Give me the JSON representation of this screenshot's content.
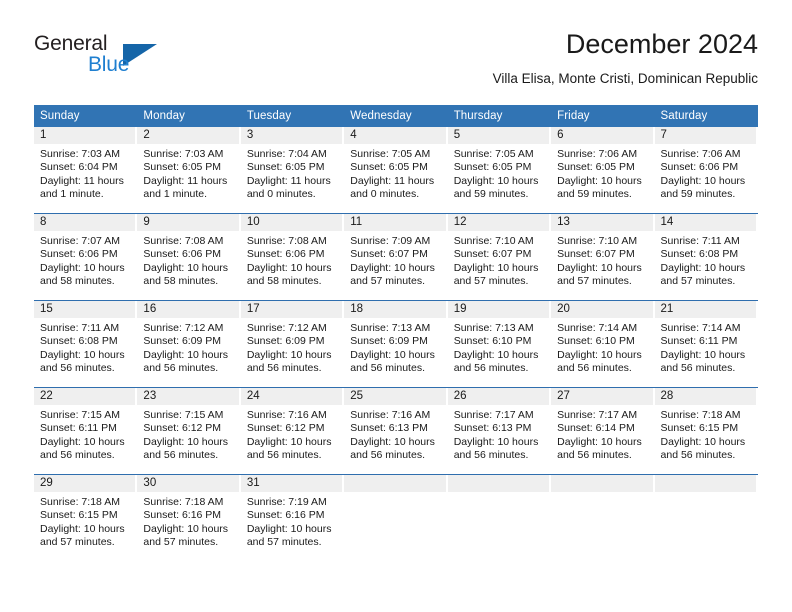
{
  "brand": {
    "name_part1": "General",
    "name_part2": "Blue",
    "triangle_color": "#1565a8",
    "blue_color": "#1f7fd0"
  },
  "header": {
    "month_title": "December 2024",
    "location": "Villa Elisa, Monte Cristi, Dominican Republic"
  },
  "theme": {
    "header_blue": "#3174b4",
    "row_divider": "#2f6eae",
    "daynum_strip": "#efefef"
  },
  "weekday_headers": [
    "Sunday",
    "Monday",
    "Tuesday",
    "Wednesday",
    "Thursday",
    "Friday",
    "Saturday"
  ],
  "weeks": [
    [
      {
        "day": "1",
        "sunrise": "Sunrise: 7:03 AM",
        "sunset": "Sunset: 6:04 PM",
        "daylight1": "Daylight: 11 hours",
        "daylight2": "and 1 minute."
      },
      {
        "day": "2",
        "sunrise": "Sunrise: 7:03 AM",
        "sunset": "Sunset: 6:05 PM",
        "daylight1": "Daylight: 11 hours",
        "daylight2": "and 1 minute."
      },
      {
        "day": "3",
        "sunrise": "Sunrise: 7:04 AM",
        "sunset": "Sunset: 6:05 PM",
        "daylight1": "Daylight: 11 hours",
        "daylight2": "and 0 minutes."
      },
      {
        "day": "4",
        "sunrise": "Sunrise: 7:05 AM",
        "sunset": "Sunset: 6:05 PM",
        "daylight1": "Daylight: 11 hours",
        "daylight2": "and 0 minutes."
      },
      {
        "day": "5",
        "sunrise": "Sunrise: 7:05 AM",
        "sunset": "Sunset: 6:05 PM",
        "daylight1": "Daylight: 10 hours",
        "daylight2": "and 59 minutes."
      },
      {
        "day": "6",
        "sunrise": "Sunrise: 7:06 AM",
        "sunset": "Sunset: 6:05 PM",
        "daylight1": "Daylight: 10 hours",
        "daylight2": "and 59 minutes."
      },
      {
        "day": "7",
        "sunrise": "Sunrise: 7:06 AM",
        "sunset": "Sunset: 6:06 PM",
        "daylight1": "Daylight: 10 hours",
        "daylight2": "and 59 minutes."
      }
    ],
    [
      {
        "day": "8",
        "sunrise": "Sunrise: 7:07 AM",
        "sunset": "Sunset: 6:06 PM",
        "daylight1": "Daylight: 10 hours",
        "daylight2": "and 58 minutes."
      },
      {
        "day": "9",
        "sunrise": "Sunrise: 7:08 AM",
        "sunset": "Sunset: 6:06 PM",
        "daylight1": "Daylight: 10 hours",
        "daylight2": "and 58 minutes."
      },
      {
        "day": "10",
        "sunrise": "Sunrise: 7:08 AM",
        "sunset": "Sunset: 6:06 PM",
        "daylight1": "Daylight: 10 hours",
        "daylight2": "and 58 minutes."
      },
      {
        "day": "11",
        "sunrise": "Sunrise: 7:09 AM",
        "sunset": "Sunset: 6:07 PM",
        "daylight1": "Daylight: 10 hours",
        "daylight2": "and 57 minutes."
      },
      {
        "day": "12",
        "sunrise": "Sunrise: 7:10 AM",
        "sunset": "Sunset: 6:07 PM",
        "daylight1": "Daylight: 10 hours",
        "daylight2": "and 57 minutes."
      },
      {
        "day": "13",
        "sunrise": "Sunrise: 7:10 AM",
        "sunset": "Sunset: 6:07 PM",
        "daylight1": "Daylight: 10 hours",
        "daylight2": "and 57 minutes."
      },
      {
        "day": "14",
        "sunrise": "Sunrise: 7:11 AM",
        "sunset": "Sunset: 6:08 PM",
        "daylight1": "Daylight: 10 hours",
        "daylight2": "and 57 minutes."
      }
    ],
    [
      {
        "day": "15",
        "sunrise": "Sunrise: 7:11 AM",
        "sunset": "Sunset: 6:08 PM",
        "daylight1": "Daylight: 10 hours",
        "daylight2": "and 56 minutes."
      },
      {
        "day": "16",
        "sunrise": "Sunrise: 7:12 AM",
        "sunset": "Sunset: 6:09 PM",
        "daylight1": "Daylight: 10 hours",
        "daylight2": "and 56 minutes."
      },
      {
        "day": "17",
        "sunrise": "Sunrise: 7:12 AM",
        "sunset": "Sunset: 6:09 PM",
        "daylight1": "Daylight: 10 hours",
        "daylight2": "and 56 minutes."
      },
      {
        "day": "18",
        "sunrise": "Sunrise: 7:13 AM",
        "sunset": "Sunset: 6:09 PM",
        "daylight1": "Daylight: 10 hours",
        "daylight2": "and 56 minutes."
      },
      {
        "day": "19",
        "sunrise": "Sunrise: 7:13 AM",
        "sunset": "Sunset: 6:10 PM",
        "daylight1": "Daylight: 10 hours",
        "daylight2": "and 56 minutes."
      },
      {
        "day": "20",
        "sunrise": "Sunrise: 7:14 AM",
        "sunset": "Sunset: 6:10 PM",
        "daylight1": "Daylight: 10 hours",
        "daylight2": "and 56 minutes."
      },
      {
        "day": "21",
        "sunrise": "Sunrise: 7:14 AM",
        "sunset": "Sunset: 6:11 PM",
        "daylight1": "Daylight: 10 hours",
        "daylight2": "and 56 minutes."
      }
    ],
    [
      {
        "day": "22",
        "sunrise": "Sunrise: 7:15 AM",
        "sunset": "Sunset: 6:11 PM",
        "daylight1": "Daylight: 10 hours",
        "daylight2": "and 56 minutes."
      },
      {
        "day": "23",
        "sunrise": "Sunrise: 7:15 AM",
        "sunset": "Sunset: 6:12 PM",
        "daylight1": "Daylight: 10 hours",
        "daylight2": "and 56 minutes."
      },
      {
        "day": "24",
        "sunrise": "Sunrise: 7:16 AM",
        "sunset": "Sunset: 6:12 PM",
        "daylight1": "Daylight: 10 hours",
        "daylight2": "and 56 minutes."
      },
      {
        "day": "25",
        "sunrise": "Sunrise: 7:16 AM",
        "sunset": "Sunset: 6:13 PM",
        "daylight1": "Daylight: 10 hours",
        "daylight2": "and 56 minutes."
      },
      {
        "day": "26",
        "sunrise": "Sunrise: 7:17 AM",
        "sunset": "Sunset: 6:13 PM",
        "daylight1": "Daylight: 10 hours",
        "daylight2": "and 56 minutes."
      },
      {
        "day": "27",
        "sunrise": "Sunrise: 7:17 AM",
        "sunset": "Sunset: 6:14 PM",
        "daylight1": "Daylight: 10 hours",
        "daylight2": "and 56 minutes."
      },
      {
        "day": "28",
        "sunrise": "Sunrise: 7:18 AM",
        "sunset": "Sunset: 6:15 PM",
        "daylight1": "Daylight: 10 hours",
        "daylight2": "and 56 minutes."
      }
    ],
    [
      {
        "day": "29",
        "sunrise": "Sunrise: 7:18 AM",
        "sunset": "Sunset: 6:15 PM",
        "daylight1": "Daylight: 10 hours",
        "daylight2": "and 57 minutes."
      },
      {
        "day": "30",
        "sunrise": "Sunrise: 7:18 AM",
        "sunset": "Sunset: 6:16 PM",
        "daylight1": "Daylight: 10 hours",
        "daylight2": "and 57 minutes."
      },
      {
        "day": "31",
        "sunrise": "Sunrise: 7:19 AM",
        "sunset": "Sunset: 6:16 PM",
        "daylight1": "Daylight: 10 hours",
        "daylight2": "and 57 minutes."
      },
      {
        "day": "",
        "sunrise": "",
        "sunset": "",
        "daylight1": "",
        "daylight2": ""
      },
      {
        "day": "",
        "sunrise": "",
        "sunset": "",
        "daylight1": "",
        "daylight2": ""
      },
      {
        "day": "",
        "sunrise": "",
        "sunset": "",
        "daylight1": "",
        "daylight2": ""
      },
      {
        "day": "",
        "sunrise": "",
        "sunset": "",
        "daylight1": "",
        "daylight2": ""
      }
    ]
  ]
}
